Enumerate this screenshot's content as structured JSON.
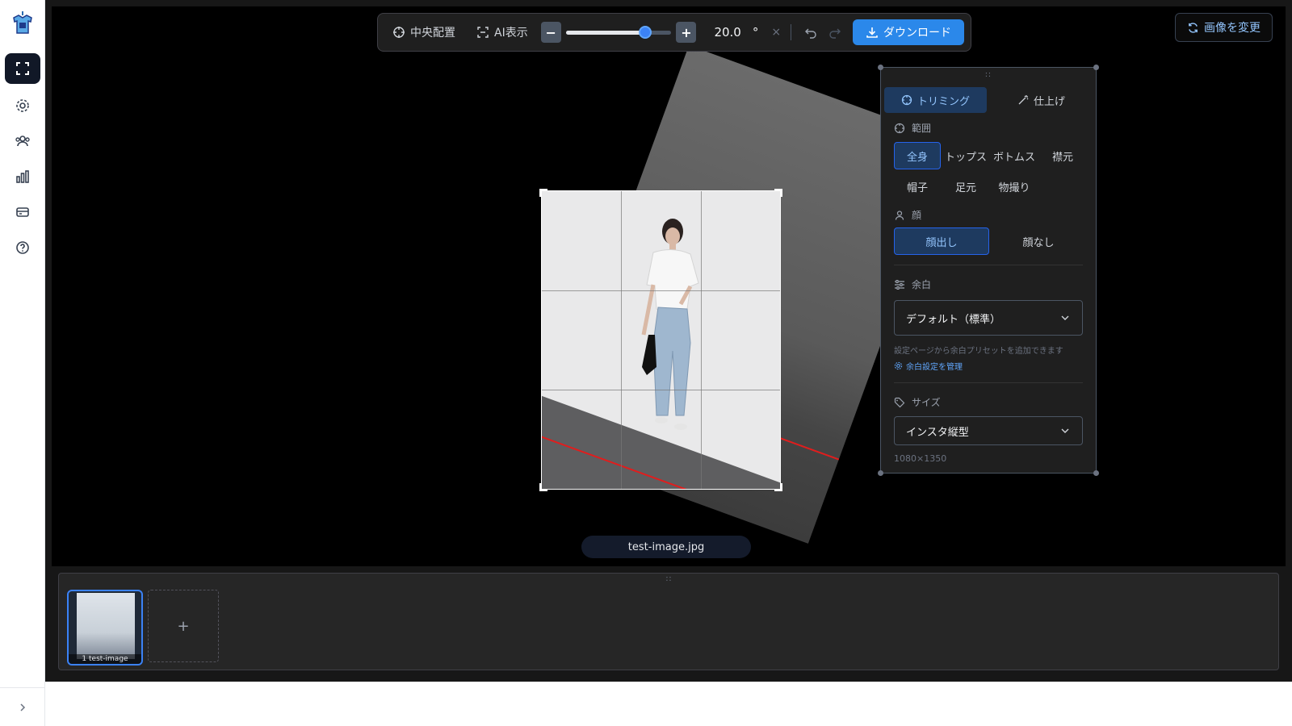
{
  "toolbar": {
    "center_label": "中央配置",
    "ai_label": "AI表示",
    "minus_label": "−",
    "plus_label": "+",
    "angle_value": "20.0",
    "angle_unit": "°",
    "reset_label": "×",
    "download_label": "ダウンロード",
    "slider_fraction": 0.69
  },
  "change_image_label": "画像を変更",
  "canvas": {
    "filename": "test-image.jpg"
  },
  "panel": {
    "tabs": [
      {
        "label": "トリミング"
      },
      {
        "label": "仕上げ"
      }
    ],
    "range": {
      "heading": "範囲",
      "options": [
        "全身",
        "トップス",
        "ボトムス",
        "襟元",
        "帽子",
        "足元",
        "物撮り"
      ],
      "selected": "全身"
    },
    "face": {
      "heading": "顔",
      "options": [
        "顔出し",
        "顔なし"
      ],
      "selected": "顔出し"
    },
    "margin": {
      "heading": "余白",
      "value": "デフォルト（標準）",
      "hint": "設定ページから余白プリセットを追加できます",
      "link": "余白設定を管理"
    },
    "size": {
      "heading": "サイズ",
      "value": "インスタ縦型",
      "dimensions": "1080×1350"
    }
  },
  "filmstrip": {
    "items": [
      {
        "label": "1 test-image"
      }
    ],
    "add_label": "+"
  },
  "colors": {
    "accent": "#2b88ea",
    "canvas_bg": "#000000",
    "panel_bg": "#1f1f1f",
    "active_chip": "#1e3a5f"
  },
  "icons": [
    "app-logo-icon",
    "fullscreen-icon",
    "gear-icon",
    "users-icon",
    "chart-icon",
    "card-icon",
    "help-icon",
    "chevron-right-icon",
    "crosshair-icon",
    "scan-icon",
    "undo-icon",
    "redo-icon",
    "download-icon",
    "refresh-icon",
    "wand-icon",
    "user-icon",
    "sliders-icon",
    "tag-icon",
    "chevron-down-icon"
  ]
}
